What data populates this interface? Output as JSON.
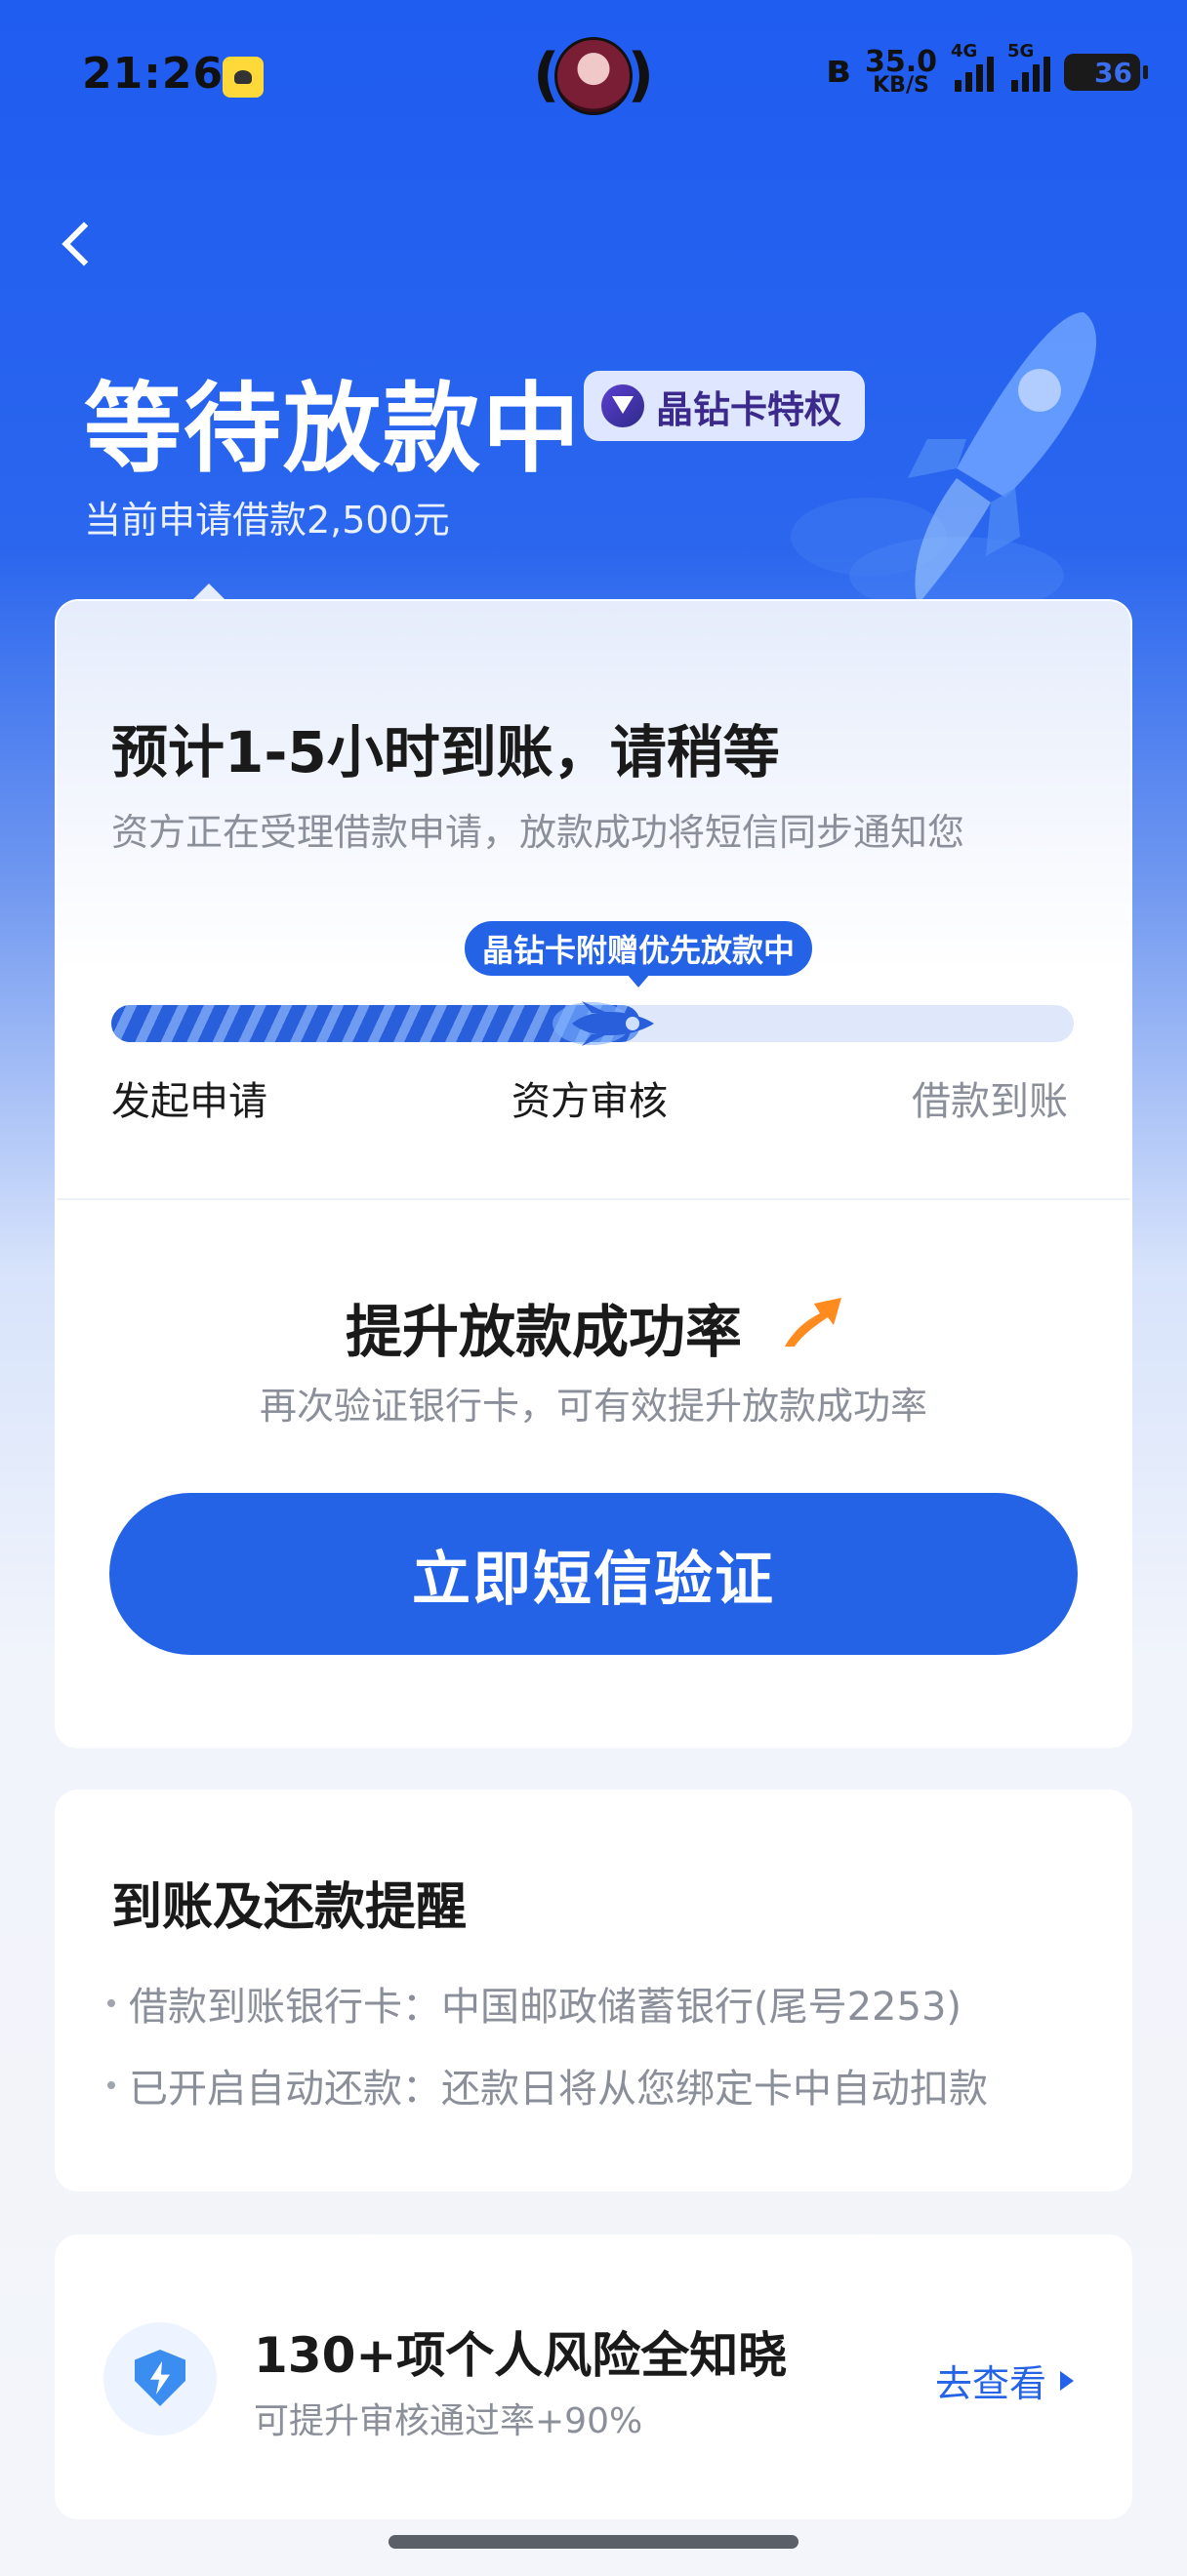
{
  "status_bar": {
    "time": "21:26",
    "app_badge": "app-badge-icon",
    "net_speed_value": "35.0",
    "net_speed_unit": "KB/S",
    "signal_1_label": "4G",
    "signal_2_label": "5G",
    "battery": "36"
  },
  "header": {
    "title": "等待放款中",
    "badge_label": "晶钻卡特权",
    "subtitle": "当前申请借款2,500元"
  },
  "progress_card": {
    "eta_title": "预计1-5小时到账，请稍等",
    "eta_desc": "资方正在受理借款申请，放款成功将短信同步通知您",
    "tip": "晶钻卡附赠优先放款中",
    "progress_fraction": 0.55,
    "steps": [
      {
        "label": "发起申请",
        "state": "done"
      },
      {
        "label": "资方审核",
        "state": "current"
      },
      {
        "label": "借款到账",
        "state": "pending"
      }
    ]
  },
  "boost": {
    "title": "提升放款成功率",
    "desc": "再次验证银行卡，可有效提升放款成功率",
    "button_label": "立即短信验证"
  },
  "reminder": {
    "title": "到账及还款提醒",
    "items": [
      "借款到账银行卡：中国邮政储蓄银行(尾号2253)",
      "已开启自动还款：还款日将从您绑定卡中自动扣款"
    ]
  },
  "risk": {
    "title": "130+项个人风险全知晓",
    "desc": "可提升审核通过率+90%",
    "link_label": "去查看"
  },
  "colors": {
    "primary": "#2563e6",
    "header_bg": "#1f5cf0",
    "muted_text": "#8a8f99"
  }
}
